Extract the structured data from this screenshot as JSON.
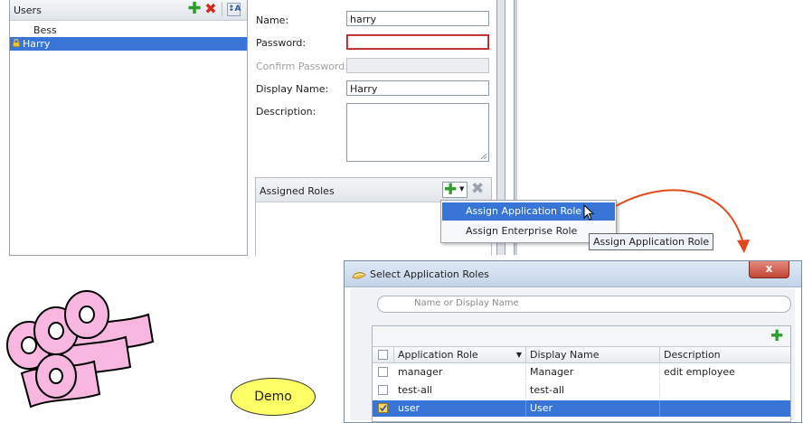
{
  "users": {
    "header": "Users",
    "list": [
      {
        "name": "Bess",
        "selected": false,
        "locked": false
      },
      {
        "name": "Harry",
        "selected": true,
        "locked": true
      }
    ]
  },
  "form": {
    "name_label": "Name:",
    "name_value": "harry",
    "password_label": "Password:",
    "confirm_label": "Confirm Password:",
    "display_label": "Display Name:",
    "display_value": "Harry",
    "description_label": "Description:"
  },
  "roles": {
    "header": "Assigned Roles"
  },
  "menu": {
    "items": [
      "Assign Application Role",
      "Assign Enterprise Role"
    ]
  },
  "tooltip": "Assign Application Role",
  "dialog": {
    "title": "Select Application Roles",
    "close_glyph": "x",
    "search_placeholder": "Name or Display Name",
    "columns": [
      "Application Role",
      "Display Name",
      "Description"
    ],
    "rows": [
      {
        "role": "manager",
        "display": "Manager",
        "description": "edit employee",
        "checked": false,
        "selected": false
      },
      {
        "role": "test-all",
        "display": "test-all",
        "description": "",
        "checked": false,
        "selected": false
      },
      {
        "role": "user",
        "display": "User",
        "description": "",
        "checked": true,
        "selected": true
      }
    ]
  },
  "demo_label": "Demo",
  "colors": {
    "selection": "#3875d7",
    "arrow": "#e04a1a",
    "demo_bg": "#ffff66"
  }
}
